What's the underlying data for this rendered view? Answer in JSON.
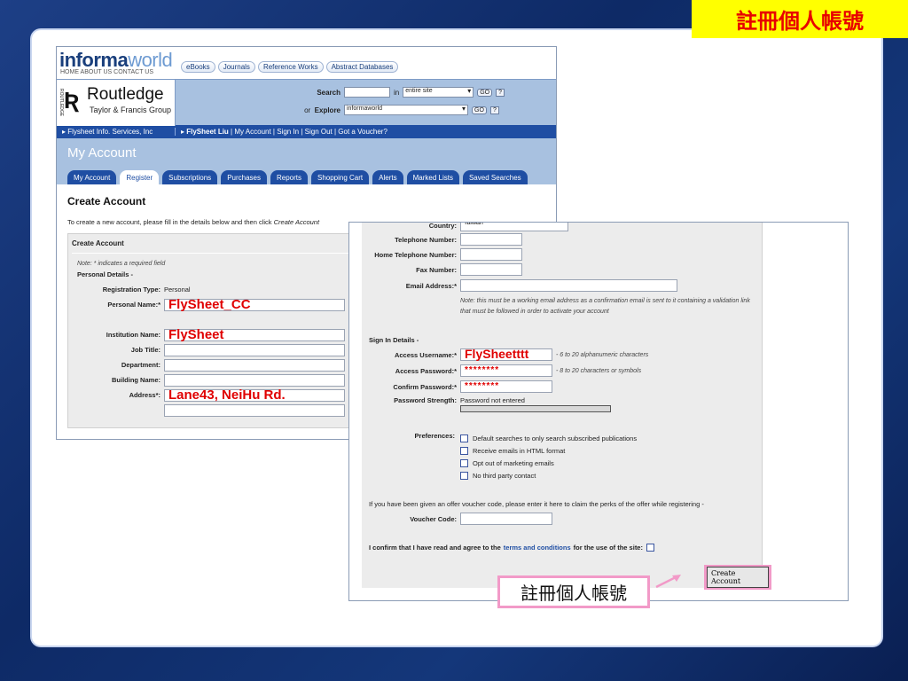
{
  "slide": {
    "title": "註冊個人帳號",
    "callout": "註冊個人帳號"
  },
  "shot1": {
    "logo_main": "informa",
    "logo_accent": "world",
    "logo_links": "HOME  ABOUT US  CONTACT US",
    "topnav": [
      "eBooks",
      "Journals",
      "Reference Works",
      "Abstract Databases"
    ],
    "publisher_name": "Routledge",
    "publisher_sub": "Taylor & Francis Group",
    "publisher_side": "ROUTLEDGE",
    "search_label": "Search",
    "search_in": "in",
    "search_scope": "entire site",
    "explore_or": "or",
    "explore_label": "Explore",
    "explore_value": "informaworld",
    "go": "GO",
    "help": "?",
    "userbar_org": "Flysheet Info. Services, Inc",
    "userbar_user": "FlySheet Liu",
    "userbar_links": "| My Account | Sign In | Sign Out | Got a Voucher?",
    "page_title": "My Account",
    "tabs": [
      "My Account",
      "Register",
      "Subscriptions",
      "Purchases",
      "Reports",
      "Shopping Cart",
      "Alerts",
      "Marked Lists",
      "Saved Searches"
    ],
    "heading": "Create Account",
    "intro_a": "To create a new account, please fill in the details below and then click ",
    "intro_b": "Create Account",
    "form_title": "Create Account",
    "note": "Note: * indicates a required field",
    "personal_details": "Personal Details -",
    "fields": {
      "reg_type_label": "Registration Type:",
      "reg_type_value": "Personal",
      "personal_name_label": "Personal Name:*",
      "personal_name_value": "FlySheet_CC",
      "institution_label": "Institution Name:",
      "institution_value": "FlySheet",
      "job_label": "Job Title:",
      "dept_label": "Department:",
      "building_label": "Building Name:",
      "address_label": "Address*:",
      "address_value": "Lane43, NeiHu Rd."
    }
  },
  "shot2": {
    "country_label": "Country:",
    "country_value": "Taiwan",
    "telephone_label": "Telephone Number:",
    "home_tel_label": "Home Telephone Number:",
    "fax_label": "Fax Number:",
    "email_label": "Email Address:*",
    "email_note": "Note: this must be a working email address as a confirmation email is sent to it containing a validation link that must be followed in order to activate your account",
    "signin_section": "Sign In Details -",
    "username_label": "Access Username:*",
    "username_value": "FlySheetttt",
    "username_hint": "- 6 to 20 alphanumeric characters",
    "password_label": "Access Password:*",
    "password_value": "********",
    "password_hint": "- 8 to 20 characters or symbols",
    "confirm_pw_label": "Confirm Password:*",
    "confirm_pw_value": "********",
    "strength_label": "Password Strength:",
    "strength_value": "Password not entered",
    "preferences_label": "Preferences:",
    "preferences": [
      "Default searches to only search subscribed publications",
      "Receive emails in HTML format",
      "Opt out of marketing emails",
      "No third party contact"
    ],
    "voucher_note": "If you have been given an offer voucher code, please enter it here to claim the perks of the offer while registering -",
    "voucher_label": "Voucher Code:",
    "confirm_a": "I confirm that I have read and agree to the",
    "confirm_link": "terms and conditions",
    "confirm_b": "for the use of the site:",
    "create_button": "Create Account"
  }
}
